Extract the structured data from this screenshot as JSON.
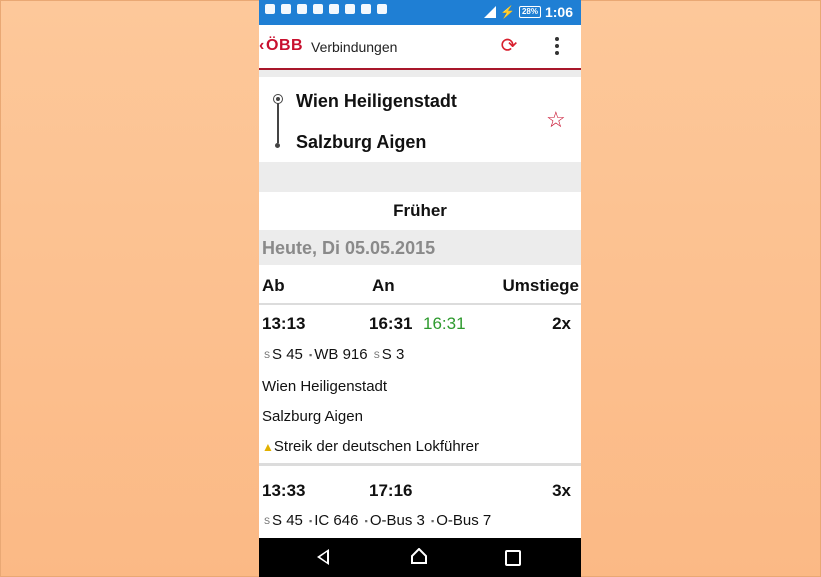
{
  "status_bar": {
    "battery": "28%",
    "time": "1:06"
  },
  "app_bar": {
    "logo": "ÖBB",
    "title": "Verbindungen",
    "refresh_icon": "refresh-icon",
    "menu_icon": "overflow-menu-icon"
  },
  "route": {
    "from": "Wien Heiligenstadt",
    "to": "Salzburg Aigen",
    "favorite_icon": "star-outline-icon"
  },
  "earlier_button": "Früher",
  "date_header": "Heute, Di 05.05.2015",
  "columns": {
    "departure": "Ab",
    "arrival": "An",
    "changes": "Umstiege"
  },
  "connections": [
    {
      "departure": "13:13",
      "arrival": "16:31",
      "arrival_realtime": "16:31",
      "changes": "2x",
      "trains": [
        "S 45",
        "WB 916",
        "S 3"
      ],
      "from": "Wien Heiligenstadt",
      "to": "Salzburg Aigen",
      "warning": "Streik der deutschen Lokführer"
    },
    {
      "departure": "13:33",
      "arrival": "17:16",
      "changes": "3x",
      "trains": [
        "S 45",
        "IC 646",
        "O-Bus 3",
        "O-Bus 7"
      ]
    }
  ],
  "colors": {
    "status_bar": "#1f7fd4",
    "brand_red": "#c8102e",
    "realtime_green": "#2e9a2e",
    "background_outer": "#fcc190"
  }
}
